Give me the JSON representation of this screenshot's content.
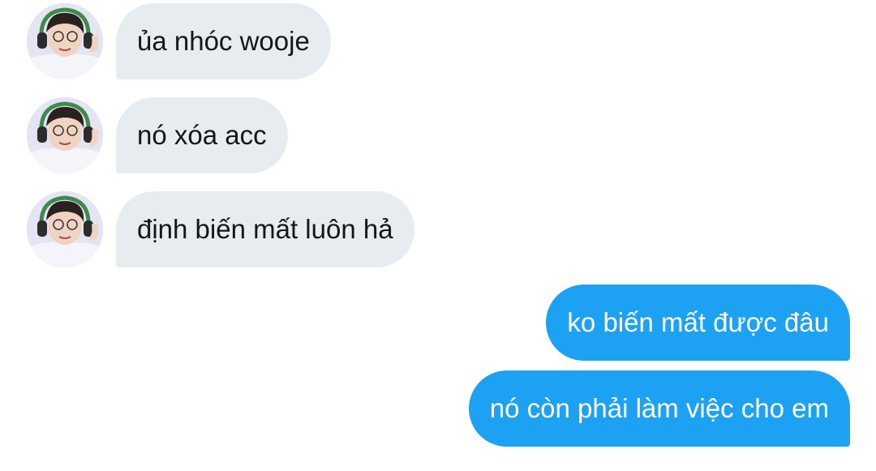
{
  "conversation": {
    "incoming": [
      {
        "text": "ủa nhóc wooje",
        "avatar": "user-avatar-icon"
      },
      {
        "text": "nó xóa acc",
        "avatar": "user-avatar-icon"
      },
      {
        "text": "định biến mất luôn hả",
        "avatar": "user-avatar-icon"
      }
    ],
    "outgoing": [
      {
        "text": "ko biến mất được đâu"
      },
      {
        "text": "nó còn phải làm việc cho em"
      }
    ]
  },
  "colors": {
    "incoming_bubble": "#e6ecf0",
    "incoming_text": "#14171a",
    "outgoing_bubble": "#1da1f2",
    "outgoing_text": "#ffffff"
  }
}
